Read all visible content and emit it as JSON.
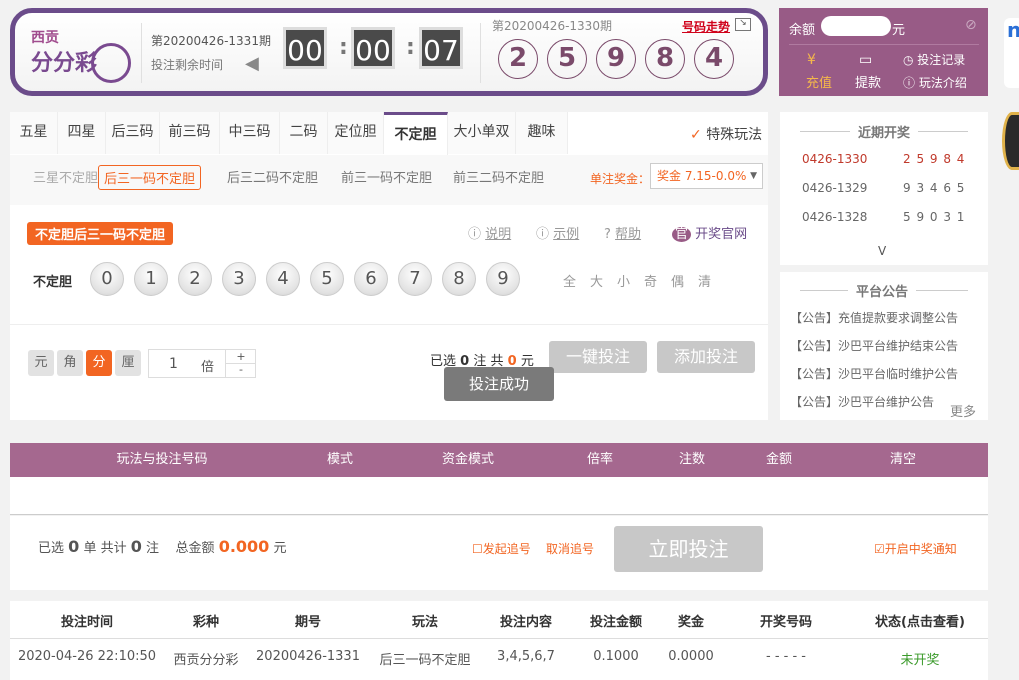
{
  "header": {
    "logo_top": "西贡",
    "logo_main": "分分彩",
    "current_issue": "第20200426-1331期",
    "remaining_label": "投注剩余时间",
    "countdown": [
      "00",
      "00",
      "07"
    ],
    "last_issue": "第20200426-1330期",
    "trend_link": "号码走势",
    "last_result": [
      "2",
      "5",
      "9",
      "8",
      "4"
    ]
  },
  "account": {
    "balance_label": "余额",
    "balance_currency": "元",
    "recharge": "充值",
    "withdraw": "提款",
    "bet_record": "投注记录",
    "rules": "玩法介绍"
  },
  "tabs": [
    "五星",
    "四星",
    "后三码",
    "前三码",
    "中三码",
    "二码",
    "定位胆",
    "不定胆",
    "大小单双",
    "趣味"
  ],
  "active_tab": 7,
  "special_play": "特殊玩法",
  "subtabs": [
    "三星不定胆",
    "后三一码不定胆",
    "后三二码不定胆",
    "前三一码不定胆",
    "前三二码不定胆"
  ],
  "active_subtab": 1,
  "prize_label": "单注奖金：",
  "prize_select": "奖金 7.15-0.0%",
  "play_badge": "不定胆后三一码不定胆",
  "links": {
    "explain": "说明",
    "example": "示例",
    "help": "帮助",
    "official": "开奖官网"
  },
  "row_label": "不定胆",
  "balls": [
    "0",
    "1",
    "2",
    "3",
    "4",
    "5",
    "6",
    "7",
    "8",
    "9"
  ],
  "quick": [
    "全",
    "大",
    "小",
    "奇",
    "偶",
    "清"
  ],
  "units": [
    "元",
    "角",
    "分",
    "厘"
  ],
  "active_unit": 2,
  "multiplier": {
    "value": "1",
    "label": "倍",
    "plus": "+",
    "minus": "-"
  },
  "selection": {
    "pre": "已选",
    "count": "0",
    "mid": "注  共",
    "amount": "0",
    "post": "元"
  },
  "buttons": {
    "quick_bet": "一键投注",
    "add_bet": "添加投注",
    "submit": "立即投注"
  },
  "toast": "投注成功",
  "recent": {
    "title": "近期开奖",
    "rows": [
      {
        "issue": "0426-1330",
        "nums": "2 5 9 8 4"
      },
      {
        "issue": "0426-1329",
        "nums": "9 3 4 6 5"
      },
      {
        "issue": "0426-1328",
        "nums": "5 9 0 3 1"
      }
    ],
    "expand": "V"
  },
  "notice": {
    "title": "平台公告",
    "items": [
      "【公告】充值提款要求调整公告",
      "【公告】沙巴平台维护结束公告",
      "【公告】沙巴平台临时维护公告",
      "【公告】沙巴平台维护公告"
    ],
    "more": "更多"
  },
  "cart": {
    "headers": [
      "玩法与投注号码",
      "模式",
      "资金模式",
      "倍率",
      "注数",
      "金额",
      "清空"
    ]
  },
  "summary": {
    "sel": "已选",
    "orders": "0",
    "unit1": "单 共计",
    "bets": "0",
    "unit2": "注",
    "total_label": "总金额",
    "total": "0.000",
    "currency": "元",
    "chase": "发起追号",
    "cancel_chase": "取消追号",
    "notify": "开启中奖通知"
  },
  "history": {
    "headers": [
      "投注时间",
      "彩种",
      "期号",
      "玩法",
      "投注内容",
      "投注金额",
      "奖金",
      "开奖号码",
      "状态(点击查看)"
    ],
    "rows": [
      [
        "2020-04-26 22:10:50",
        "西贡分分彩",
        "20200426-1331",
        "后三一码不定胆",
        "3,4,5,6,7",
        "0.1000",
        "0.0000",
        "- - - - -",
        "未开奖"
      ]
    ]
  },
  "colors": {
    "purple": "#6b4c8a",
    "mauve": "#985b86",
    "orange": "#f26522",
    "green": "#3a9a2a"
  }
}
